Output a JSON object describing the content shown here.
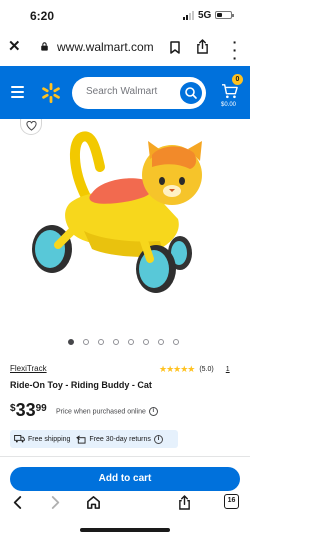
{
  "status_bar": {
    "time": "6:20",
    "network": "5G"
  },
  "browser": {
    "url": "www.walmart.com"
  },
  "header": {
    "search_placeholder": "Search Walmart",
    "cart_count": "0",
    "cart_amount": "$0.00",
    "brand_color": "#0071dc",
    "spark_color": "#ffc220"
  },
  "gallery": {
    "image_count": 8,
    "active_index": 0
  },
  "product": {
    "brand": "FlexiTrack",
    "title": "Ride-On Toy - Riding Buddy - Cat",
    "rating_score": "(5.0)",
    "rating_stars": "★★★★★",
    "review_count": "1",
    "currency": "$",
    "price_dollars": "33",
    "price_cents": "99",
    "price_note": "Price when purchased online",
    "free_shipping": "Free shipping",
    "free_returns": "Free 30-day returns"
  },
  "actions": {
    "add_to_cart": "Add to cart"
  },
  "bottom_bar": {
    "tabs_count": "16"
  },
  "icons": [
    "close-icon",
    "lock-icon",
    "bookmark-icon",
    "share-icon",
    "more-icon",
    "menu-icon",
    "spark-logo-icon",
    "search-icon",
    "cart-icon",
    "heart-icon",
    "star-icon",
    "info-icon",
    "truck-icon",
    "return-icon",
    "back-icon",
    "forward-icon",
    "home-icon",
    "tabs-icon"
  ]
}
